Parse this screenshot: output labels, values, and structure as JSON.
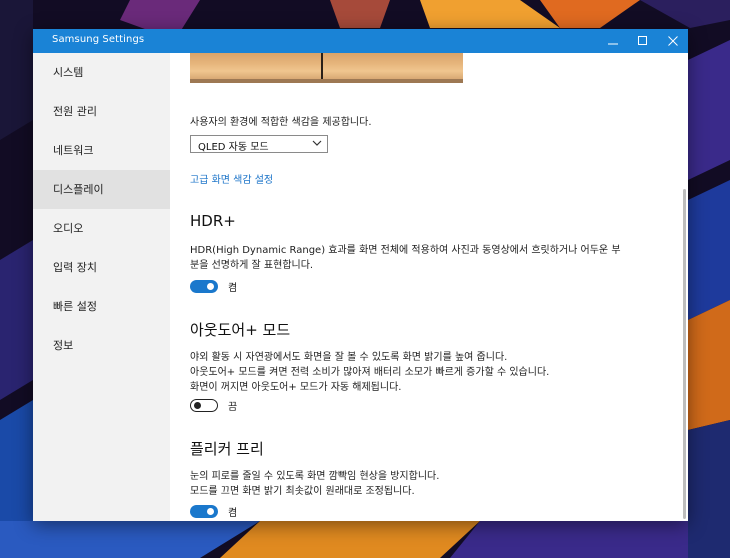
{
  "window": {
    "title": "Samsung Settings"
  },
  "sidebar": {
    "items": [
      {
        "label": "시스템"
      },
      {
        "label": "전원 관리"
      },
      {
        "label": "네트워크"
      },
      {
        "label": "디스플레이",
        "selected": true
      },
      {
        "label": "오디오"
      },
      {
        "label": "입력 장치"
      },
      {
        "label": "빠른 설정"
      },
      {
        "label": "정보"
      }
    ]
  },
  "display": {
    "color_desc": "사용자의 환경에 적합한 색감을 제공합니다.",
    "color_mode": "QLED 자동 모드",
    "advanced_link": "고급 화면 색감 설정",
    "hdr": {
      "title": "HDR+",
      "desc_line1": "HDR(High Dynamic Range) 효과를 화면 전체에 적용하여 사진과 동영상에서 흐릿하거나 어두운 부",
      "desc_line2": "분을 선명하게 잘 표현합니다.",
      "state_label": "켬",
      "on": true
    },
    "outdoor": {
      "title": "아웃도어+ 모드",
      "desc_line1": "야외 활동 시 자연광에서도 화면을 잘 볼 수 있도록 화면 밝기를 높여 줍니다.",
      "desc_line2": "아웃도어+ 모드를 켜면 전력 소비가 많아져 배터리 소모가 빠르게 증가할 수 있습니다.",
      "desc_line3": "화면이 꺼지면 아웃도어+ 모드가 자동 해제됩니다.",
      "state_label": "끔",
      "on": false
    },
    "flicker": {
      "title": "플리커 프리",
      "desc_line1": "눈의 피로를 줄일 수 있도록 화면 깜빡임 현상을 방지합니다.",
      "desc_line2": "모드를 끄면 화면 밝기 최솟값이 원래대로 조정됩니다.",
      "state_label": "켬",
      "on": true
    }
  },
  "colors": {
    "titlebar": "#1a83d6",
    "toggle_on": "#1a78cc",
    "link": "#1a73c8"
  }
}
